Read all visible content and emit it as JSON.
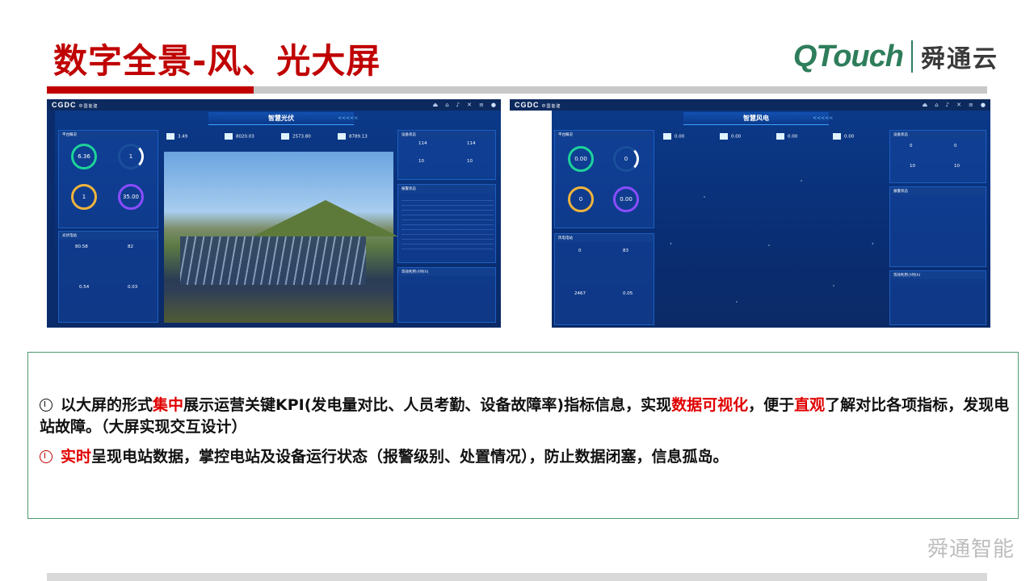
{
  "title": "数字全景-风、光大屏",
  "logo": {
    "brand": "QTouch",
    "cn": "舜通云"
  },
  "solar_screen": {
    "title": "智慧光伏",
    "panel_overview": "平台概况",
    "ring_values": [
      "6.36",
      "1",
      "1",
      "35.00"
    ],
    "top_kpis": [
      "3.49",
      "8020.03",
      "2573.80",
      "8789.13"
    ],
    "device_status": "设备状态",
    "device_values": [
      "114",
      "114",
      "10",
      "10"
    ],
    "panel_generation": "光伏电站",
    "gen_values": [
      "80.58",
      "82",
      "0.54",
      "0.03"
    ],
    "alarm_panel": "报警状态",
    "bottom_panel": "等效利用小时(h)"
  },
  "wind_screen": {
    "title": "智慧风电",
    "panel_overview": "平台概况",
    "ring_values": [
      "0.00",
      "0",
      "0",
      "0.00"
    ],
    "top_kpis": [
      "0.00",
      "0.00",
      "0.00",
      "0.00"
    ],
    "device_status": "设备状态",
    "device_values": [
      "0",
      "0",
      "10",
      "10"
    ],
    "panel_generation": "风电电站",
    "gen_values": [
      "0",
      "83",
      "2467",
      "0.05"
    ],
    "alarm_panel": "报警状态",
    "bottom_panel": "等效利用小时(h)"
  },
  "bullets": [
    {
      "parts": [
        {
          "text": "以大屏的形式",
          "hl": false
        },
        {
          "text": "集中",
          "hl": true
        },
        {
          "text": "展示运营关键KPI(发电量对比、人员考勤、设备故障率)指标信息，实现",
          "hl": false
        },
        {
          "text": "数据可视化",
          "hl": true
        },
        {
          "text": "，便于",
          "hl": false
        },
        {
          "text": "直观",
          "hl": true
        },
        {
          "text": "了解对比各项指标，发现电站故障。（大屏实现交互设计）",
          "hl": false
        }
      ]
    },
    {
      "parts": [
        {
          "text": "实时",
          "hl": true
        },
        {
          "text": "呈现电站数据，掌控电站及设备运行状态（报警级别、处置情况），防止数据闭塞，信息孤岛。",
          "hl": false
        }
      ]
    }
  ],
  "footer": "舜通智能",
  "colors": {
    "title_red": "#c00000",
    "highlight": "#e00000",
    "brand_green": "#2e7d5b"
  }
}
